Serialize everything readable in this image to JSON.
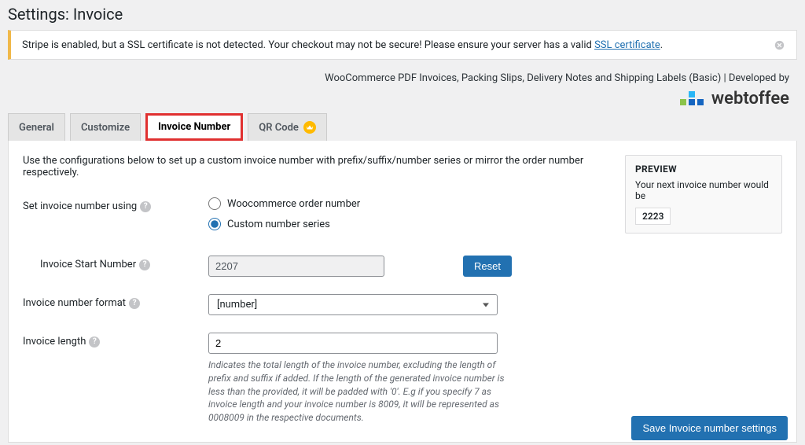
{
  "page_title": "Settings: Invoice",
  "notice": {
    "text_prefix": "Stripe is enabled, but a SSL certificate is not detected. Your checkout may not be secure! Please ensure your server has a valid ",
    "link_text": "SSL certificate",
    "text_suffix": "."
  },
  "dev_line": "WooCommerce PDF Invoices, Packing Slips, Delivery Notes and Shipping Labels (Basic) | Developed by",
  "brand": "webtoffee",
  "tabs": {
    "general": "General",
    "customize": "Customize",
    "invoice_number": "Invoice Number",
    "qr_code": "QR Code"
  },
  "intro": "Use the configurations below to set up a custom invoice number with prefix/suffix/number series or mirror the order number respectively.",
  "labels": {
    "set_using": "Set invoice number using",
    "start_number": "Invoice Start Number",
    "format": "Invoice number format",
    "length": "Invoice length"
  },
  "radios": {
    "woo": "Woocommerce order number",
    "custom": "Custom number series"
  },
  "fields": {
    "start_number": "2207",
    "format": "[number]",
    "length": "2"
  },
  "buttons": {
    "reset": "Reset",
    "save": "Save Invoice number settings"
  },
  "length_help": "Indicates the total length of the invoice number, excluding the length of prefix and suffix if added. If the length of the generated invoice number is less than the provided, it will be padded with '0'. E.g if you specify 7 as invoice length and your invoice number is 8009, it will be represented as 0008009 in the respective documents.",
  "preview": {
    "title": "PREVIEW",
    "text": "Your next invoice number would be",
    "value": "2223"
  }
}
